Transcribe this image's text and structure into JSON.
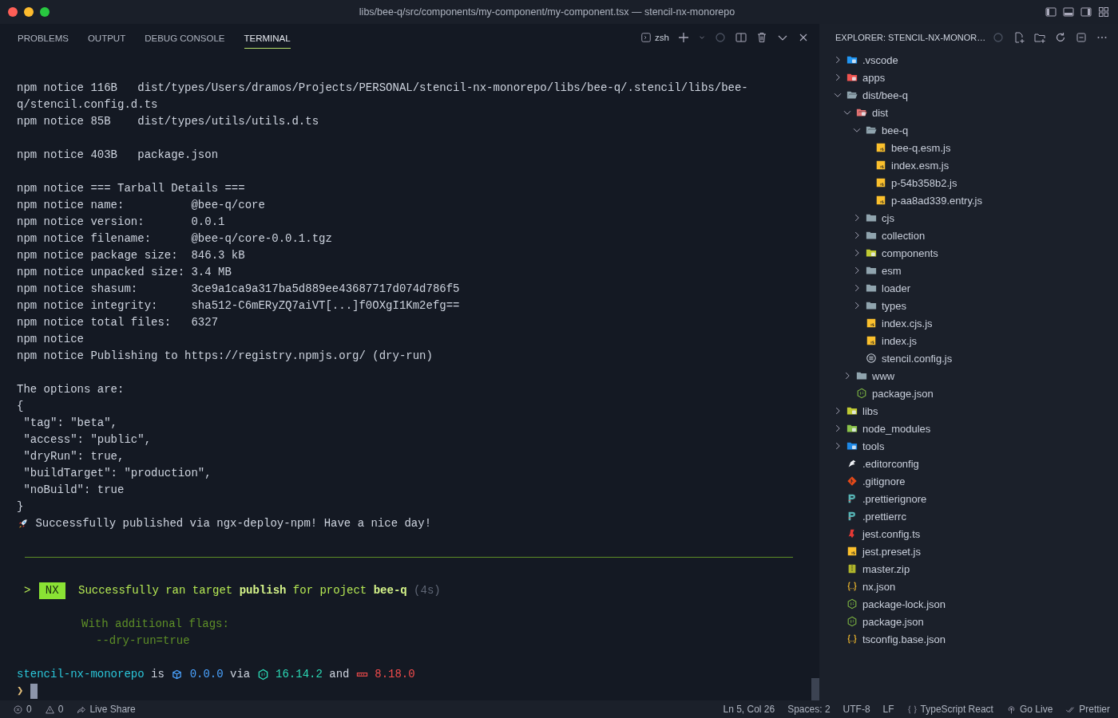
{
  "window": {
    "title": "libs/bee-q/src/components/my-component/my-component.tsx — stencil-nx-monorepo"
  },
  "panel": {
    "tabs": [
      {
        "label": "PROBLEMS",
        "selected": false
      },
      {
        "label": "OUTPUT",
        "selected": false
      },
      {
        "label": "DEBUG CONSOLE",
        "selected": false
      },
      {
        "label": "TERMINAL",
        "selected": true
      }
    ],
    "shell": "zsh"
  },
  "terminal": {
    "lines": [
      {
        "kind": "text",
        "text": "npm notice 116B   dist/types/Users/dramos/Projects/PERSONAL/stencil-nx-monorepo/libs/bee-q/.stencil/libs/bee-"
      },
      {
        "kind": "text",
        "text": "q/stencil.config.d.ts"
      },
      {
        "kind": "text",
        "text": "npm notice 85B    dist/types/utils/utils.d.ts"
      },
      {
        "kind": "blank"
      },
      {
        "kind": "text",
        "text": "npm notice 403B   package.json"
      },
      {
        "kind": "blank"
      },
      {
        "kind": "text",
        "text": "npm notice === Tarball Details ==="
      },
      {
        "kind": "text",
        "text": "npm notice name:          @bee-q/core"
      },
      {
        "kind": "text",
        "text": "npm notice version:       0.0.1"
      },
      {
        "kind": "text",
        "text": "npm notice filename:      @bee-q/core-0.0.1.tgz"
      },
      {
        "kind": "text",
        "text": "npm notice package size:  846.3 kB"
      },
      {
        "kind": "text",
        "text": "npm notice unpacked size: 3.4 MB"
      },
      {
        "kind": "text",
        "text": "npm notice shasum:        3ce9a1ca9a317ba5d889ee43687717d074d786f5"
      },
      {
        "kind": "text",
        "text": "npm notice integrity:     sha512-C6mERyZQ7aiVT[...]f0OXgI1Km2efg=="
      },
      {
        "kind": "text",
        "text": "npm notice total files:   6327"
      },
      {
        "kind": "text",
        "text": "npm notice"
      },
      {
        "kind": "text",
        "text": "npm notice Publishing to https://registry.npmjs.org/ (dry-run)"
      },
      {
        "kind": "blank"
      },
      {
        "kind": "text",
        "text": "The options are:"
      },
      {
        "kind": "text",
        "text": "{"
      },
      {
        "kind": "text",
        "text": " \"tag\": \"beta\","
      },
      {
        "kind": "text",
        "text": " \"access\": \"public\","
      },
      {
        "kind": "text",
        "text": " \"dryRun\": true,"
      },
      {
        "kind": "text",
        "text": " \"buildTarget\": \"production\","
      },
      {
        "kind": "text",
        "text": " \"noBuild\": true"
      },
      {
        "kind": "text",
        "text": "}"
      },
      {
        "kind": "segments",
        "segments": [
          {
            "kind": "rocket"
          },
          {
            "kind": "plain",
            "text": "Successfully published via ngx-deploy-npm! Have a nice day!"
          }
        ]
      },
      {
        "kind": "blank"
      },
      {
        "kind": "rule"
      },
      {
        "kind": "blank"
      },
      {
        "kind": "segments",
        "segments": [
          {
            "kind": "green",
            "text": ">"
          },
          {
            "kind": "badge",
            "text": "NX"
          },
          {
            "kind": "green",
            "text": "Successfully ran target **publish** for project **bee-q**"
          },
          {
            "kind": "grey",
            "text": "(4s)"
          }
        ]
      },
      {
        "kind": "blank"
      },
      {
        "kind": "flag-heading",
        "text": "With additional flags:"
      },
      {
        "kind": "flag-value",
        "text": "--dry-run=true"
      },
      {
        "kind": "blank"
      },
      {
        "kind": "segments",
        "segments": [
          {
            "kind": "cyan",
            "text": "stencil-nx-monorepo"
          },
          {
            "kind": "plain",
            "text": "is"
          },
          {
            "kind": "package"
          },
          {
            "kind": "blue",
            "text": "0.0.0"
          },
          {
            "kind": "plain",
            "text": "via"
          },
          {
            "kind": "node"
          },
          {
            "kind": "teal",
            "text": "16.14.2"
          },
          {
            "kind": "plain",
            "text": "and"
          },
          {
            "kind": "npm"
          },
          {
            "kind": "red",
            "text": "8.18.0"
          }
        ]
      },
      {
        "kind": "segments",
        "segments": [
          {
            "kind": "yellow",
            "text": "❯"
          },
          {
            "kind": "cursor"
          }
        ]
      }
    ]
  },
  "explorer": {
    "title": "EXPLORER: STENCIL-NX-MONOR…",
    "tree": [
      {
        "label": ".vscode",
        "kind": "vscode-folder",
        "expanded": false
      },
      {
        "label": "apps",
        "kind": "apps-folder",
        "expanded": false
      },
      {
        "label": "dist/bee-q",
        "kind": "folder",
        "expanded": true,
        "children": [
          {
            "label": "dist",
            "kind": "dist-folder",
            "expanded": true,
            "children": [
              {
                "label": "bee-q",
                "kind": "folder",
                "expanded": true,
                "children": [
                  {
                    "label": "bee-q.esm.js",
                    "kind": "js"
                  },
                  {
                    "label": "index.esm.js",
                    "kind": "js"
                  },
                  {
                    "label": "p-54b358b2.js",
                    "kind": "js"
                  },
                  {
                    "label": "p-aa8ad339.entry.js",
                    "kind": "js"
                  }
                ]
              },
              {
                "label": "cjs",
                "kind": "folder",
                "expanded": false
              },
              {
                "label": "collection",
                "kind": "folder",
                "expanded": false
              },
              {
                "label": "components",
                "kind": "components-folder",
                "expanded": false
              },
              {
                "label": "esm",
                "kind": "folder",
                "expanded": false
              },
              {
                "label": "loader",
                "kind": "folder",
                "expanded": false
              },
              {
                "label": "types",
                "kind": "folder",
                "expanded": false
              },
              {
                "label": "index.cjs.js",
                "kind": "js"
              },
              {
                "label": "index.js",
                "kind": "js"
              },
              {
                "label": "stencil.config.js",
                "kind": "stencil"
              }
            ]
          },
          {
            "label": "www",
            "kind": "folder",
            "expanded": false
          },
          {
            "label": "package.json",
            "kind": "node"
          }
        ]
      },
      {
        "label": "libs",
        "kind": "libs-folder",
        "expanded": false
      },
      {
        "label": "node_modules",
        "kind": "node-folder",
        "expanded": false
      },
      {
        "label": "tools",
        "kind": "tools-folder",
        "expanded": false
      },
      {
        "label": ".editorconfig",
        "kind": "editorconfig"
      },
      {
        "label": ".gitignore",
        "kind": "git"
      },
      {
        "label": ".prettierignore",
        "kind": "prettier"
      },
      {
        "label": ".prettierrc",
        "kind": "prettier"
      },
      {
        "label": "jest.config.ts",
        "kind": "jest"
      },
      {
        "label": "jest.preset.js",
        "kind": "js"
      },
      {
        "label": "master.zip",
        "kind": "zip"
      },
      {
        "label": "nx.json",
        "kind": "json"
      },
      {
        "label": "package-lock.json",
        "kind": "node"
      },
      {
        "label": "package.json",
        "kind": "node"
      },
      {
        "label": "tsconfig.base.json",
        "kind": "json"
      }
    ]
  },
  "status_bar": {
    "left": [
      {
        "kind": "errors",
        "text": "0"
      },
      {
        "kind": "warnings",
        "text": "0"
      },
      {
        "kind": "live-share",
        "text": "Live Share"
      }
    ],
    "right": [
      {
        "kind": "plain",
        "text": "Ln 5, Col 26"
      },
      {
        "kind": "plain",
        "text": "Spaces: 2"
      },
      {
        "kind": "plain",
        "text": "UTF-8"
      },
      {
        "kind": "plain",
        "text": "LF"
      },
      {
        "kind": "language",
        "text": "TypeScript React"
      },
      {
        "kind": "go-live",
        "text": "Go Live"
      },
      {
        "kind": "prettier",
        "text": "Prettier"
      }
    ]
  }
}
